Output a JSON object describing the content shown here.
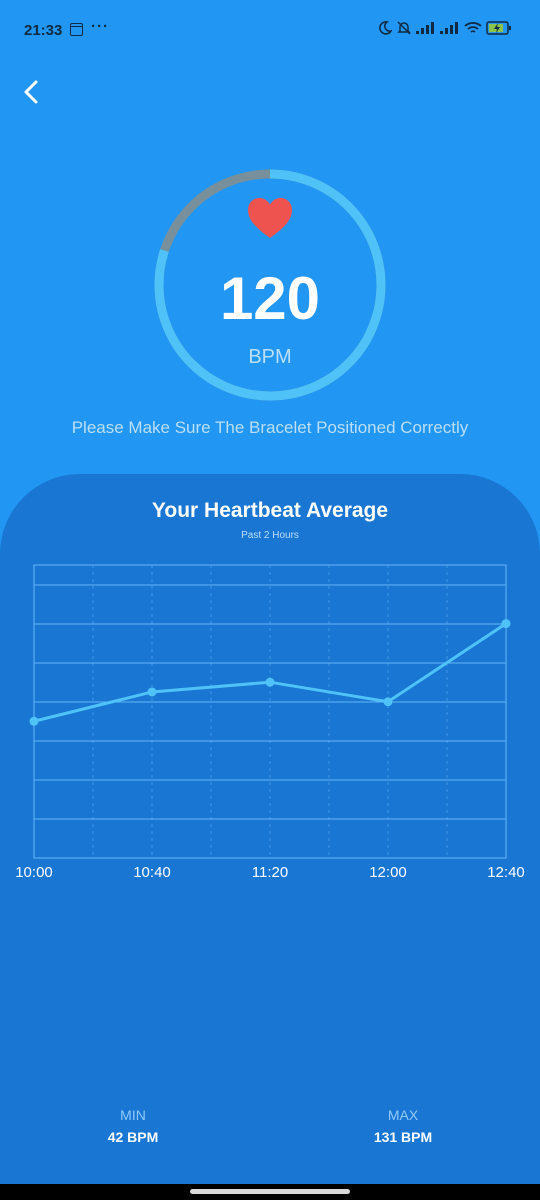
{
  "status_bar": {
    "time": "21:33",
    "calendar_day": "1",
    "more": "···"
  },
  "heart_rate": {
    "value": "120",
    "unit": "BPM",
    "ring_progress": 0.8,
    "hint": "Please Make Sure The Bracelet Positioned Correctly"
  },
  "chart_panel": {
    "title": "Your Heartbeat Average",
    "subtitle": "Past 2 Hours"
  },
  "chart_data": {
    "type": "line",
    "title": "Your Heartbeat Average",
    "subtitle": "Past 2 Hours",
    "x": [
      "10:00",
      "10:40",
      "11:20",
      "12:00",
      "12:40"
    ],
    "series": [
      {
        "values": [
          70,
          85,
          90,
          80,
          120
        ]
      }
    ],
    "ylim": [
      0,
      150
    ],
    "grid": true,
    "colors": {
      "line": "#4FC3F7",
      "grid": "#64B5F6"
    }
  },
  "stats": {
    "min_label": "MIN",
    "min_value": "42 BPM",
    "max_label": "MAX",
    "max_value": "131 BPM"
  },
  "colors": {
    "background": "#2196F3",
    "panel": "#1976D2",
    "ring_active": "#4FC3F7",
    "ring_inactive": "#78909C",
    "heart": "#EF5350"
  }
}
